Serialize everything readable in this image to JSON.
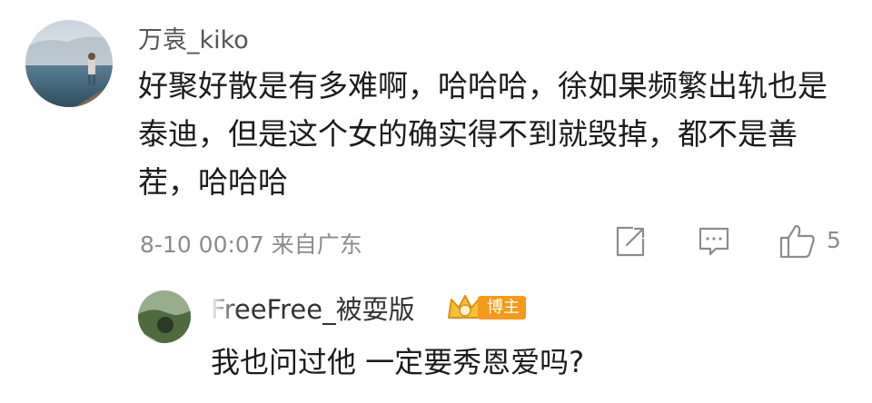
{
  "comment": {
    "username": "万袁_kiko",
    "text": "好聚好散是有多难啊，哈哈哈，徐如果频繁出轨也是泰迪，但是这个女的确实得不到就毁掉，都不是善茬，哈哈哈",
    "timestamp": "8-10 00:07",
    "location": "来自广东",
    "like_count": "5",
    "icons": {
      "share": "share-icon",
      "reply": "reply-comment-icon",
      "like": "thumbs-up-icon"
    }
  },
  "reply": {
    "username_faded": "Fre",
    "username": "eFree_被耍版",
    "badge_label": "博主",
    "text": "我也问过他 一定要秀恩爱吗?"
  },
  "colors": {
    "meta_gray": "#8c8c8c",
    "badge_orange": "#f49a18",
    "text_dark": "#1c1c1c"
  }
}
